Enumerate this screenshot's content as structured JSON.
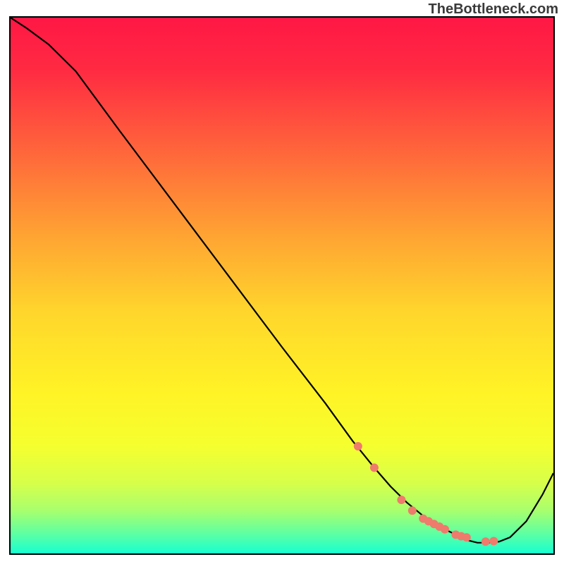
{
  "watermark": "TheBottleneck.com",
  "chart_data": {
    "type": "line",
    "title": "",
    "xlabel": "",
    "ylabel": "",
    "xlim": [
      0,
      100
    ],
    "ylim": [
      0,
      100
    ],
    "grid": false,
    "legend": null,
    "series": [
      {
        "name": "bottleneck-curve",
        "color": "#000000",
        "x": [
          0,
          3,
          7,
          12,
          20,
          30,
          40,
          50,
          58,
          63,
          67,
          70,
          73,
          76,
          79,
          82,
          84,
          86,
          88,
          90,
          92,
          95,
          98,
          100
        ],
        "y": [
          100,
          98,
          95,
          90,
          79,
          65.5,
          52,
          38.5,
          28,
          21,
          16,
          12.5,
          9.5,
          7,
          5,
          3.5,
          2.5,
          2,
          2,
          2.2,
          3,
          6,
          11,
          15
        ]
      }
    ],
    "markers": {
      "name": "highlight-dots",
      "color": "#ee7b6c",
      "x": [
        64,
        67,
        72,
        74,
        76,
        77,
        78,
        79,
        80,
        82,
        83,
        84,
        87.5,
        89
      ],
      "y": [
        20,
        16,
        10,
        8,
        6.5,
        6,
        5.5,
        5,
        4.5,
        3.5,
        3.2,
        3,
        2.2,
        2.3
      ]
    },
    "background_gradient": {
      "stops": [
        {
          "offset": 0.0,
          "color": "#ff1745"
        },
        {
          "offset": 0.1,
          "color": "#ff2b42"
        },
        {
          "offset": 0.25,
          "color": "#ff663b"
        },
        {
          "offset": 0.4,
          "color": "#ffa133"
        },
        {
          "offset": 0.55,
          "color": "#ffd62c"
        },
        {
          "offset": 0.7,
          "color": "#fff326"
        },
        {
          "offset": 0.8,
          "color": "#f5ff2f"
        },
        {
          "offset": 0.87,
          "color": "#d6ff4a"
        },
        {
          "offset": 0.92,
          "color": "#a8ff6e"
        },
        {
          "offset": 0.96,
          "color": "#64ff9f"
        },
        {
          "offset": 1.0,
          "color": "#17ffd1"
        }
      ]
    }
  }
}
